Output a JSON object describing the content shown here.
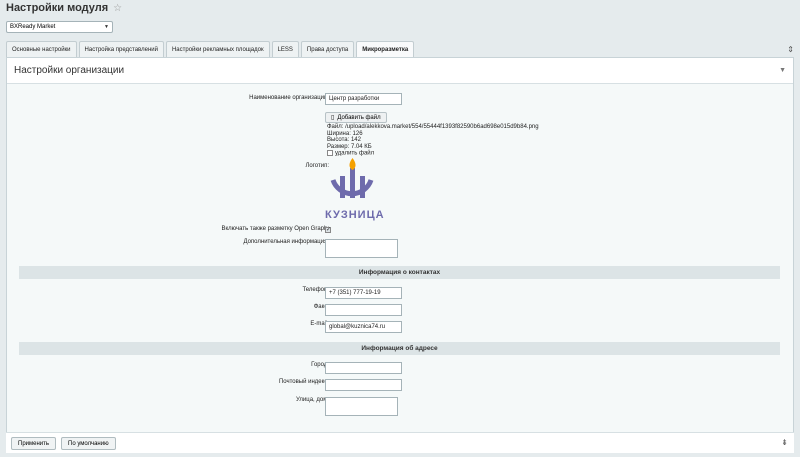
{
  "page": {
    "title": "Настройки модуля"
  },
  "module_select": {
    "value": "BXReady Market"
  },
  "tabs": [
    {
      "label": "Основные настройки"
    },
    {
      "label": "Настройка представлений"
    },
    {
      "label": "Настройки рекламных площадок"
    },
    {
      "label": "LESS"
    },
    {
      "label": "Права доступа"
    },
    {
      "label": "Микроразметка"
    }
  ],
  "panel": {
    "title": "Настройки организации"
  },
  "form": {
    "org_name_label": "Наименование организации:",
    "org_name_value": "Центр разработки",
    "add_file_label": "Добавить файл",
    "file_path": "Файл: /upload/alekkova.market/554/55444f1393f82590b6ad698e015d9b84.png",
    "file_width": "Ширина: 126",
    "file_height": "Высота: 142",
    "file_size": "Размер: 7.04 КБ",
    "delete_file_label": "удалить файл",
    "logo_label": "Логотип:",
    "logo_text": "КУЗНИЦА",
    "open_graph_label": "Включать также разметку Open Graph:",
    "additional_info_label": "Дополнительная информация:"
  },
  "contacts": {
    "section_title": "Информация о контактах",
    "phone_label": "Телефон:",
    "phone_value": "+7 (351) 777-19-19",
    "fax_label": "Факс:",
    "fax_value": "",
    "email_label": "E-mail:",
    "email_value": "global@kuznica74.ru"
  },
  "address": {
    "section_title": "Информация об адресе",
    "city_label": "Город:",
    "zip_label": "Почтовый индекс:",
    "street_label": "Улица, дом:"
  },
  "footer": {
    "apply_label": "Применить",
    "default_label": "По умолчанию"
  },
  "colors": {
    "logo": "#6e6bac",
    "accent": "#f5a000",
    "section_bg": "#dce4e6"
  }
}
